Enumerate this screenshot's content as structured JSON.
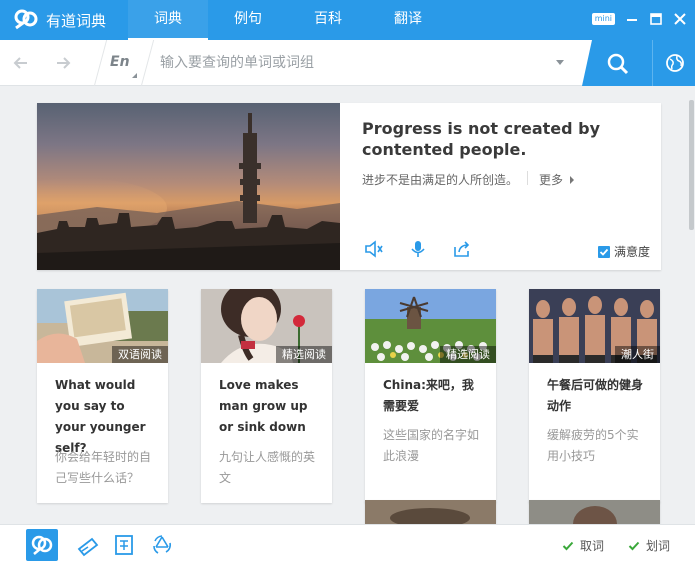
{
  "app": {
    "name": "有道词典"
  },
  "nav": {
    "tabs": [
      {
        "label": "词典"
      },
      {
        "label": "例句"
      },
      {
        "label": "百科"
      },
      {
        "label": "翻译"
      }
    ],
    "active": "词典"
  },
  "window_controls": {
    "mini_label": "mini"
  },
  "search": {
    "lang_label": "En",
    "placeholder": "输入要查询的单词或词组",
    "value": ""
  },
  "hero": {
    "english": "Progress is not created by contented people.",
    "chinese": "进步不是由满足的人所创造。",
    "more_label": "更多",
    "satisfaction_label": "满意度",
    "satisfaction_checked": true
  },
  "cards": [
    {
      "tag": "双语阅读",
      "title": "What would you say to your younger self?",
      "desc": "你会给年轻时的自己写些什么话？"
    },
    {
      "tag": "精选阅读",
      "title": "Love makes man grow up or sink down",
      "desc": "九句让人感慨的英文"
    },
    {
      "tag": "精选阅读",
      "title": "China:来吧，我需要爱",
      "desc": "这些国家的名字如此浪漫"
    },
    {
      "tag": "潮人街",
      "title": "午餐后可做的健身动作",
      "desc": "缓解疲劳的5个实用小技巧"
    }
  ],
  "bottom": {
    "quick_lookup_label": "取词",
    "select_lookup_label": "划词"
  },
  "colors": {
    "accent": "#2a9ae8",
    "check_green": "#3aa83a",
    "background": "#eef0f2"
  },
  "icons": [
    "youdao-logo-icon",
    "back-arrow-icon",
    "forward-arrow-icon",
    "search-icon",
    "globe-icon",
    "speaker-icon",
    "microphone-icon",
    "share-icon",
    "checkbox-icon",
    "wordbook-icon",
    "translate-icon",
    "recycle-icon",
    "check-icon"
  ]
}
